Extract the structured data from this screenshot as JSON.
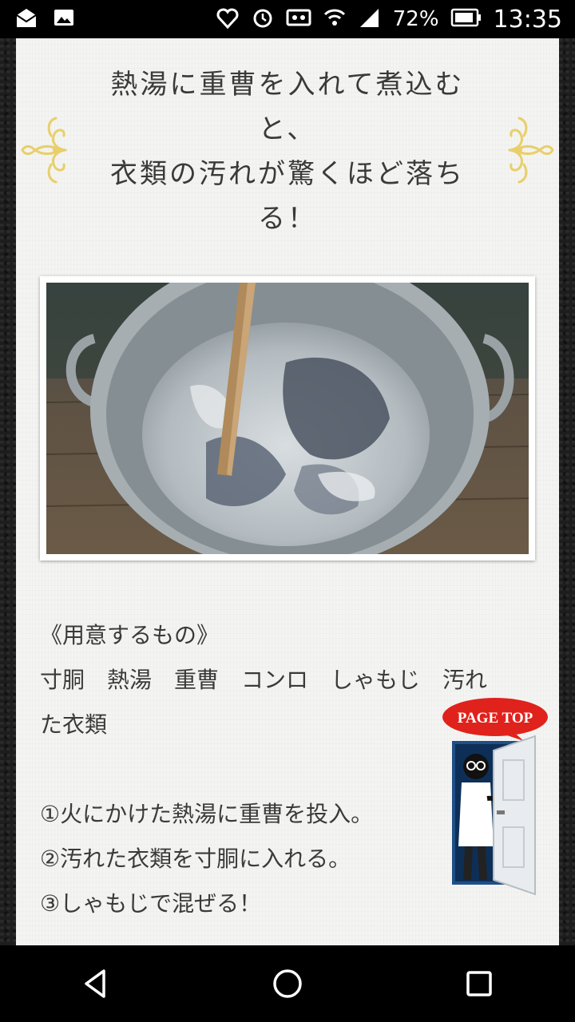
{
  "status_bar": {
    "battery_percent": "72%",
    "time": "13:35",
    "icons": [
      "mail-icon",
      "image-icon",
      "heart-shield-icon",
      "alarm-icon",
      "video-icon",
      "wifi-icon",
      "signal-icon",
      "battery-icon"
    ]
  },
  "article": {
    "heading": "熱湯に重曹を入れて煮込む\nと、\n衣類の汚れが驚くほど落ち\nる！",
    "photo_alt": "pot-of-clothes-photo",
    "lines": [
      "《用意するもの》",
      "寸胴　熱湯　重曹　コンロ　しゃもじ　汚れ",
      "た衣類",
      "",
      "①火にかけた熱湯に重曹を投入。",
      "②汚れた衣類を寸胴に入れる。",
      "③しゃもじで混ぜる！"
    ]
  },
  "page_top": {
    "label": "PAGE TOP"
  },
  "navigation": {
    "buttons": [
      "back-icon",
      "home-icon",
      "recents-icon"
    ]
  },
  "colors": {
    "text": "#3a3a3a",
    "ornament": "#e8cf6a",
    "badge": "#e0221c",
    "background": "#f4f4f2"
  }
}
